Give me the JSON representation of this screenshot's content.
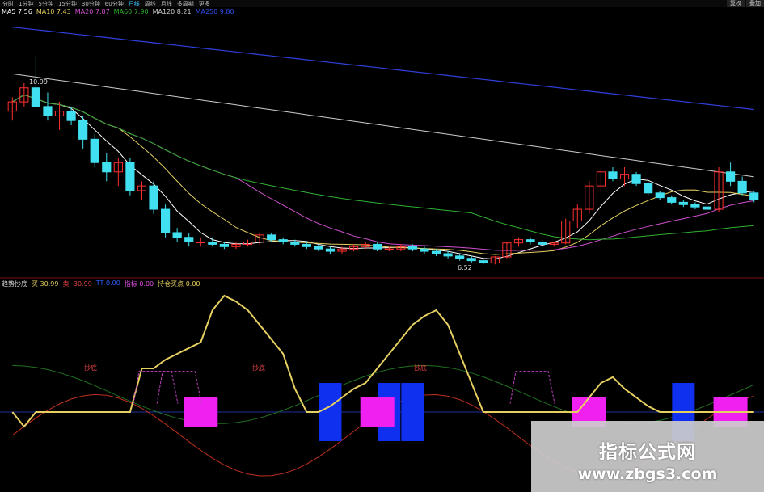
{
  "toolbar": {
    "items": [
      "分时",
      "1分钟",
      "5分钟",
      "15分钟",
      "30分钟",
      "60分钟",
      "日线",
      "周线",
      "月线",
      "多周期",
      "更多"
    ],
    "active_index": 6,
    "right": [
      "复权",
      "叠加"
    ]
  },
  "price_legend": {
    "title": "MA5 7.56",
    "ma10": "MA10 7.43",
    "ma20": "MA20 7.87",
    "ma60": "MA60 7.90",
    "ma120": "MA120 8.21",
    "ma250": "MA250 9.80",
    "colors": {
      "ma5": "#ffffff",
      "ma10": "#e6d060",
      "ma20": "#d050d0",
      "ma60": "#30b030",
      "ma120": "#cccccc",
      "ma250": "#3040e0"
    }
  },
  "indicator_legend": {
    "name": "趋势抄底",
    "buy": "买 30.99",
    "sell": "卖 -30.99",
    "tt": "TT 0.00",
    "signal": "指标 0.00",
    "extra": "持仓买点 0.00"
  },
  "annotations": {
    "high_label": "10.99",
    "low_label": "6.52",
    "buy_marks": [
      "抄底",
      "抄底",
      "抄底"
    ]
  },
  "watermark": {
    "title": "指标公式网",
    "url": "www.zbgs3.com"
  },
  "chart_data": {
    "type": "candlestick",
    "candles": [
      [
        9.8,
        10.1,
        9.6,
        10.0
      ],
      [
        10.0,
        10.4,
        9.9,
        10.3
      ],
      [
        10.3,
        10.99,
        10.0,
        9.9
      ],
      [
        9.9,
        10.2,
        9.6,
        9.7
      ],
      [
        9.7,
        10.0,
        9.4,
        9.8
      ],
      [
        9.8,
        9.9,
        9.5,
        9.6
      ],
      [
        9.6,
        9.7,
        9.0,
        9.2
      ],
      [
        9.2,
        9.3,
        8.6,
        8.7
      ],
      [
        8.7,
        8.9,
        8.3,
        8.5
      ],
      [
        8.5,
        8.8,
        8.2,
        8.7
      ],
      [
        8.7,
        8.8,
        8.0,
        8.1
      ],
      [
        8.1,
        8.3,
        7.9,
        8.2
      ],
      [
        8.2,
        8.3,
        7.6,
        7.7
      ],
      [
        7.7,
        7.8,
        7.1,
        7.2
      ],
      [
        7.2,
        7.3,
        7.0,
        7.1
      ],
      [
        7.1,
        7.2,
        6.9,
        7.0
      ],
      [
        7.0,
        7.1,
        6.9,
        7.0
      ],
      [
        7.0,
        7.1,
        6.9,
        6.95
      ],
      [
        6.95,
        7.0,
        6.85,
        6.9
      ],
      [
        6.9,
        7.0,
        6.85,
        6.95
      ],
      [
        6.95,
        7.05,
        6.9,
        7.0
      ],
      [
        7.0,
        7.2,
        6.95,
        7.15
      ],
      [
        7.15,
        7.2,
        7.0,
        7.05
      ],
      [
        7.05,
        7.1,
        6.95,
        7.0
      ],
      [
        7.0,
        7.05,
        6.9,
        6.95
      ],
      [
        6.95,
        7.0,
        6.85,
        6.9
      ],
      [
        6.9,
        6.95,
        6.8,
        6.85
      ],
      [
        6.85,
        6.9,
        6.75,
        6.8
      ],
      [
        6.8,
        6.9,
        6.75,
        6.85
      ],
      [
        6.85,
        6.95,
        6.8,
        6.9
      ],
      [
        6.9,
        7.0,
        6.85,
        6.95
      ],
      [
        6.95,
        7.0,
        6.8,
        6.85
      ],
      [
        6.85,
        6.9,
        6.8,
        6.85
      ],
      [
        6.85,
        6.95,
        6.8,
        6.9
      ],
      [
        6.9,
        6.95,
        6.8,
        6.85
      ],
      [
        6.85,
        6.9,
        6.75,
        6.8
      ],
      [
        6.8,
        6.85,
        6.7,
        6.75
      ],
      [
        6.75,
        6.8,
        6.65,
        6.7
      ],
      [
        6.7,
        6.75,
        6.6,
        6.65
      ],
      [
        6.65,
        6.7,
        6.55,
        6.6
      ],
      [
        6.6,
        6.65,
        6.52,
        6.55
      ],
      [
        6.55,
        6.7,
        6.52,
        6.68
      ],
      [
        6.68,
        7.0,
        6.65,
        6.98
      ],
      [
        6.98,
        7.1,
        6.9,
        7.05
      ],
      [
        7.05,
        7.1,
        6.95,
        7.0
      ],
      [
        7.0,
        7.05,
        6.9,
        6.95
      ],
      [
        6.95,
        7.0,
        6.9,
        6.98
      ],
      [
        6.98,
        7.5,
        6.95,
        7.45
      ],
      [
        7.45,
        7.8,
        7.3,
        7.7
      ],
      [
        7.7,
        8.3,
        7.6,
        8.2
      ],
      [
        8.2,
        8.6,
        8.1,
        8.5
      ],
      [
        8.5,
        8.6,
        8.3,
        8.35
      ],
      [
        8.35,
        8.6,
        8.2,
        8.45
      ],
      [
        8.45,
        8.5,
        8.2,
        8.25
      ],
      [
        8.25,
        8.3,
        8.0,
        8.05
      ],
      [
        8.05,
        8.1,
        7.9,
        7.95
      ],
      [
        7.95,
        8.0,
        7.8,
        7.85
      ],
      [
        7.85,
        7.9,
        7.75,
        7.8
      ],
      [
        7.8,
        7.85,
        7.7,
        7.75
      ],
      [
        7.75,
        7.8,
        7.65,
        7.7
      ],
      [
        7.7,
        8.6,
        7.65,
        8.5
      ],
      [
        8.5,
        8.7,
        8.2,
        8.3
      ],
      [
        8.3,
        8.4,
        8.0,
        8.05
      ],
      [
        8.05,
        8.1,
        7.85,
        7.9
      ]
    ],
    "indicator": {
      "yellow": [
        0,
        -5,
        0,
        0,
        0,
        0,
        0,
        0,
        0,
        0,
        0,
        15,
        15,
        18,
        20,
        22,
        24,
        35,
        40,
        38,
        35,
        30,
        25,
        20,
        8,
        0,
        0,
        2,
        5,
        8,
        10,
        15,
        20,
        25,
        30,
        33,
        35,
        30,
        20,
        10,
        0,
        0,
        0,
        0,
        0,
        0,
        0,
        0,
        0,
        5,
        10,
        12,
        8,
        5,
        2,
        0,
        0,
        0,
        0,
        0,
        0,
        0,
        0,
        0
      ],
      "buy_markers": [
        12,
        14,
        44
      ],
      "blue_bars": [
        27,
        32,
        34,
        57
      ],
      "magenta_boxes": [
        16,
        31,
        49,
        61
      ]
    }
  }
}
